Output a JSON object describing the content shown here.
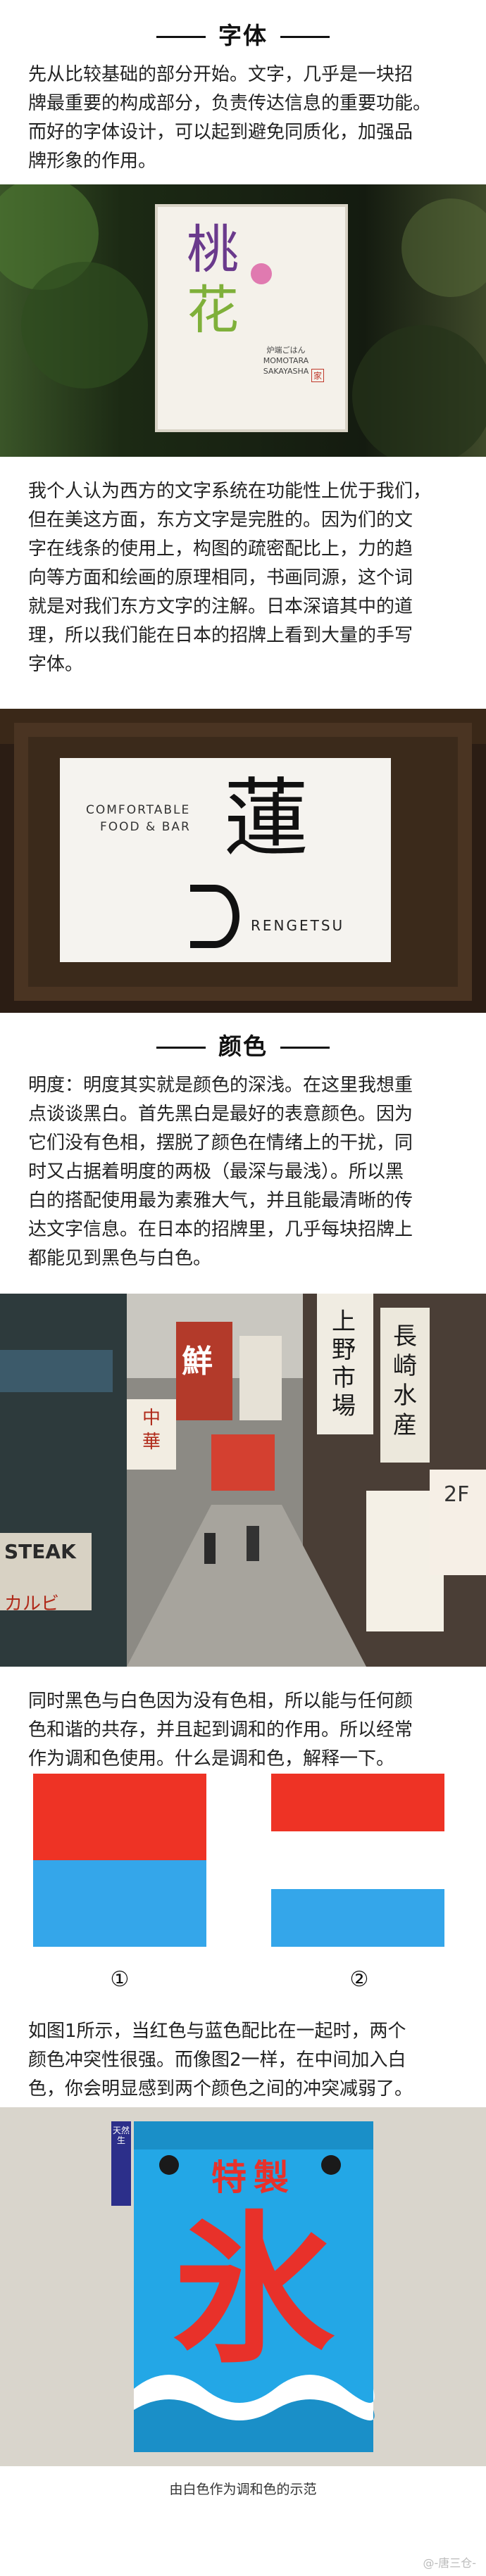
{
  "section1": {
    "heading": "字体",
    "para1": "先从比较基础的部分开始。文字，几乎是一块招\n牌最重要的构成部分，负责传达信息的重要功能。\n而好的字体设计，可以起到避免同质化，加强品\n牌形象的作用。",
    "photo1": {
      "sign_title_lines": [
        "桃",
        "花"
      ],
      "sign_small_text": [
        "炉端ごはん",
        "MOMOTARA",
        "SAKAYASHA"
      ],
      "sign_mark": "家"
    },
    "para2": "我个人认为西方的文字系统在功能性上优于我们，\n但在美这方面，东方文字是完胜的。因为们的文\n字在线条的使用上，构图的疏密配比上，力的趋\n向等方面和绘画的原理相同，书画同源，这个词\n就是对我们东方文字的注解。日本深谙其中的道\n理，所以我们能在日本的招牌上看到大量的手写\n字体。",
    "photo2": {
      "sign_line1": "COMFORTABLE",
      "sign_line2": "FOOD & BAR",
      "sign_kanji": "蓮",
      "sign_name": "RENGETSU"
    }
  },
  "section2": {
    "heading": "颜色",
    "para1": "明度：明度其实就是颜色的深浅。在这里我想重\n点谈谈黑白。首先黑白是最好的表意颜色。因为\n它们没有色相，摆脱了颜色在情绪上的干扰，同\n时又占据着明度的两极（最深与最浅）。所以黑\n白的搭配使用最为素雅大气，并且能最清晰的传\n达文字信息。在日本的招牌里，几乎每块招牌上\n都能见到黑色与白色。",
    "photo3": {
      "signs": [
        "上野市場",
        "長崎水産",
        "鮮",
        "中華",
        "STEAK",
        "カルビ",
        "2F"
      ]
    },
    "para2": "同时黑色与白色因为没有色相，所以能与任何颜\n色和谐的共存，并且起到调和的作用。所以经常\n作为调和色使用。什么是调和色，解释一下。",
    "figures": {
      "label1": "①",
      "label2": "②",
      "red": "#ee3325",
      "blue": "#34a6ea",
      "white": "#ffffff"
    },
    "para3": "如图1所示，当红色与蓝色配比在一起时，两个\n颜色冲突性很强。而像图2一样，在中间加入白\n色，你会明显感到两个颜色之间的冲突减弱了。",
    "photo4": {
      "banner_top": "特製",
      "banner_main": "氷",
      "tag_text": "天然生"
    },
    "caption": "由白色作为调和色的示范"
  },
  "watermark": "@-唐三仓-"
}
